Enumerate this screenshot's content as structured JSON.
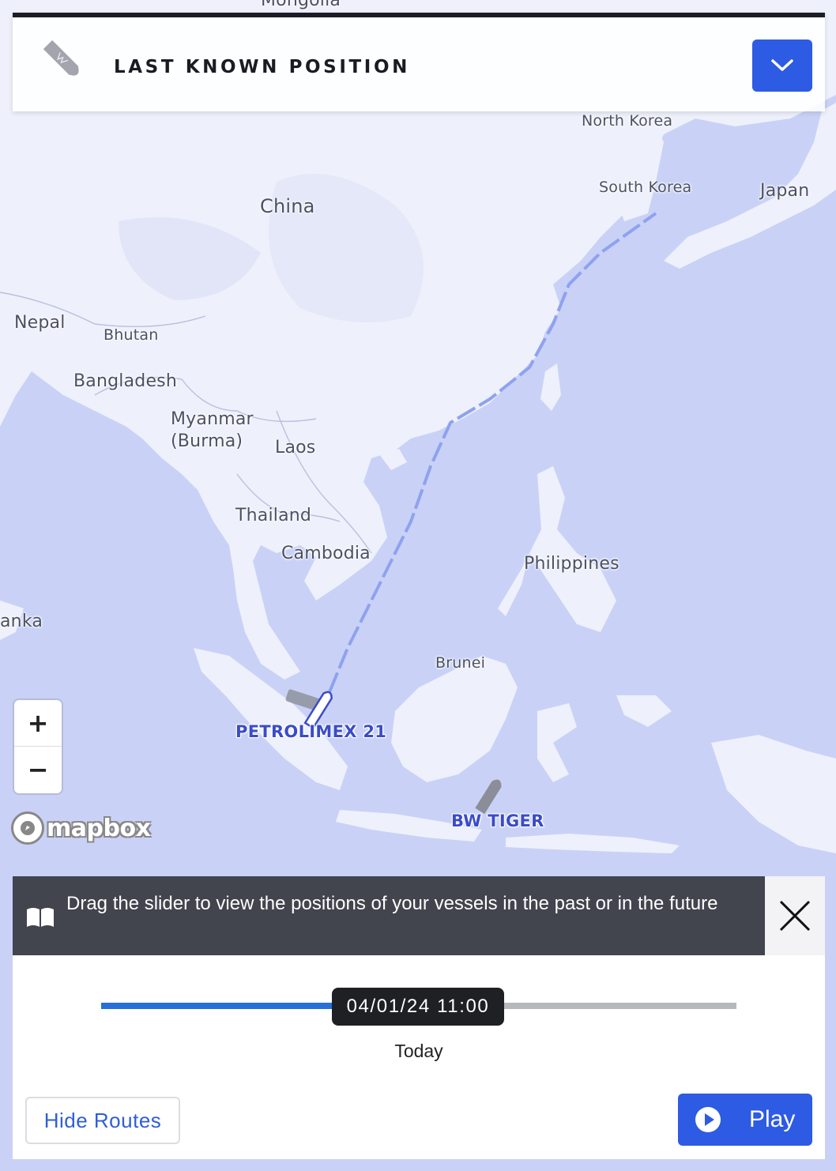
{
  "header": {
    "title": "LAST KNOWN POSITION",
    "ship_icon": "ship-icon",
    "dropdown_icon": "chevron-down-icon"
  },
  "map": {
    "labels": {
      "mongolia": "Mongolia",
      "north_korea": "North Korea",
      "south_korea": "South Korea",
      "japan": "Japan",
      "china": "China",
      "nepal": "Nepal",
      "bhutan": "Bhutan",
      "bangladesh": "Bangladesh",
      "myanmar": "Myanmar\n(Burma)",
      "laos": "Laos",
      "thailand": "Thailand",
      "cambodia": "Cambodia",
      "philippines": "Philippines",
      "sri_lanka": "anka",
      "brunei": "Brunei"
    },
    "vessels": [
      {
        "name": "PETROLIMEX 21"
      },
      {
        "name": "BW TIGER"
      }
    ],
    "zoom_in": "+",
    "zoom_out": "−",
    "attribution": "mapbox",
    "colors": {
      "water": "#c9d2f6",
      "land": "#eef0fb",
      "route": "#8fa2ee"
    }
  },
  "hint": {
    "text": "Drag the slider to view the positions of your vessels in the past or in the future",
    "icon": "book-icon",
    "close_icon": "close-icon"
  },
  "timeline": {
    "current": "04/01/24 11:00",
    "caption": "Today",
    "position_fraction": 0.5
  },
  "actions": {
    "hide_routes": "Hide Routes",
    "play": "Play",
    "play_icon": "play-icon"
  }
}
